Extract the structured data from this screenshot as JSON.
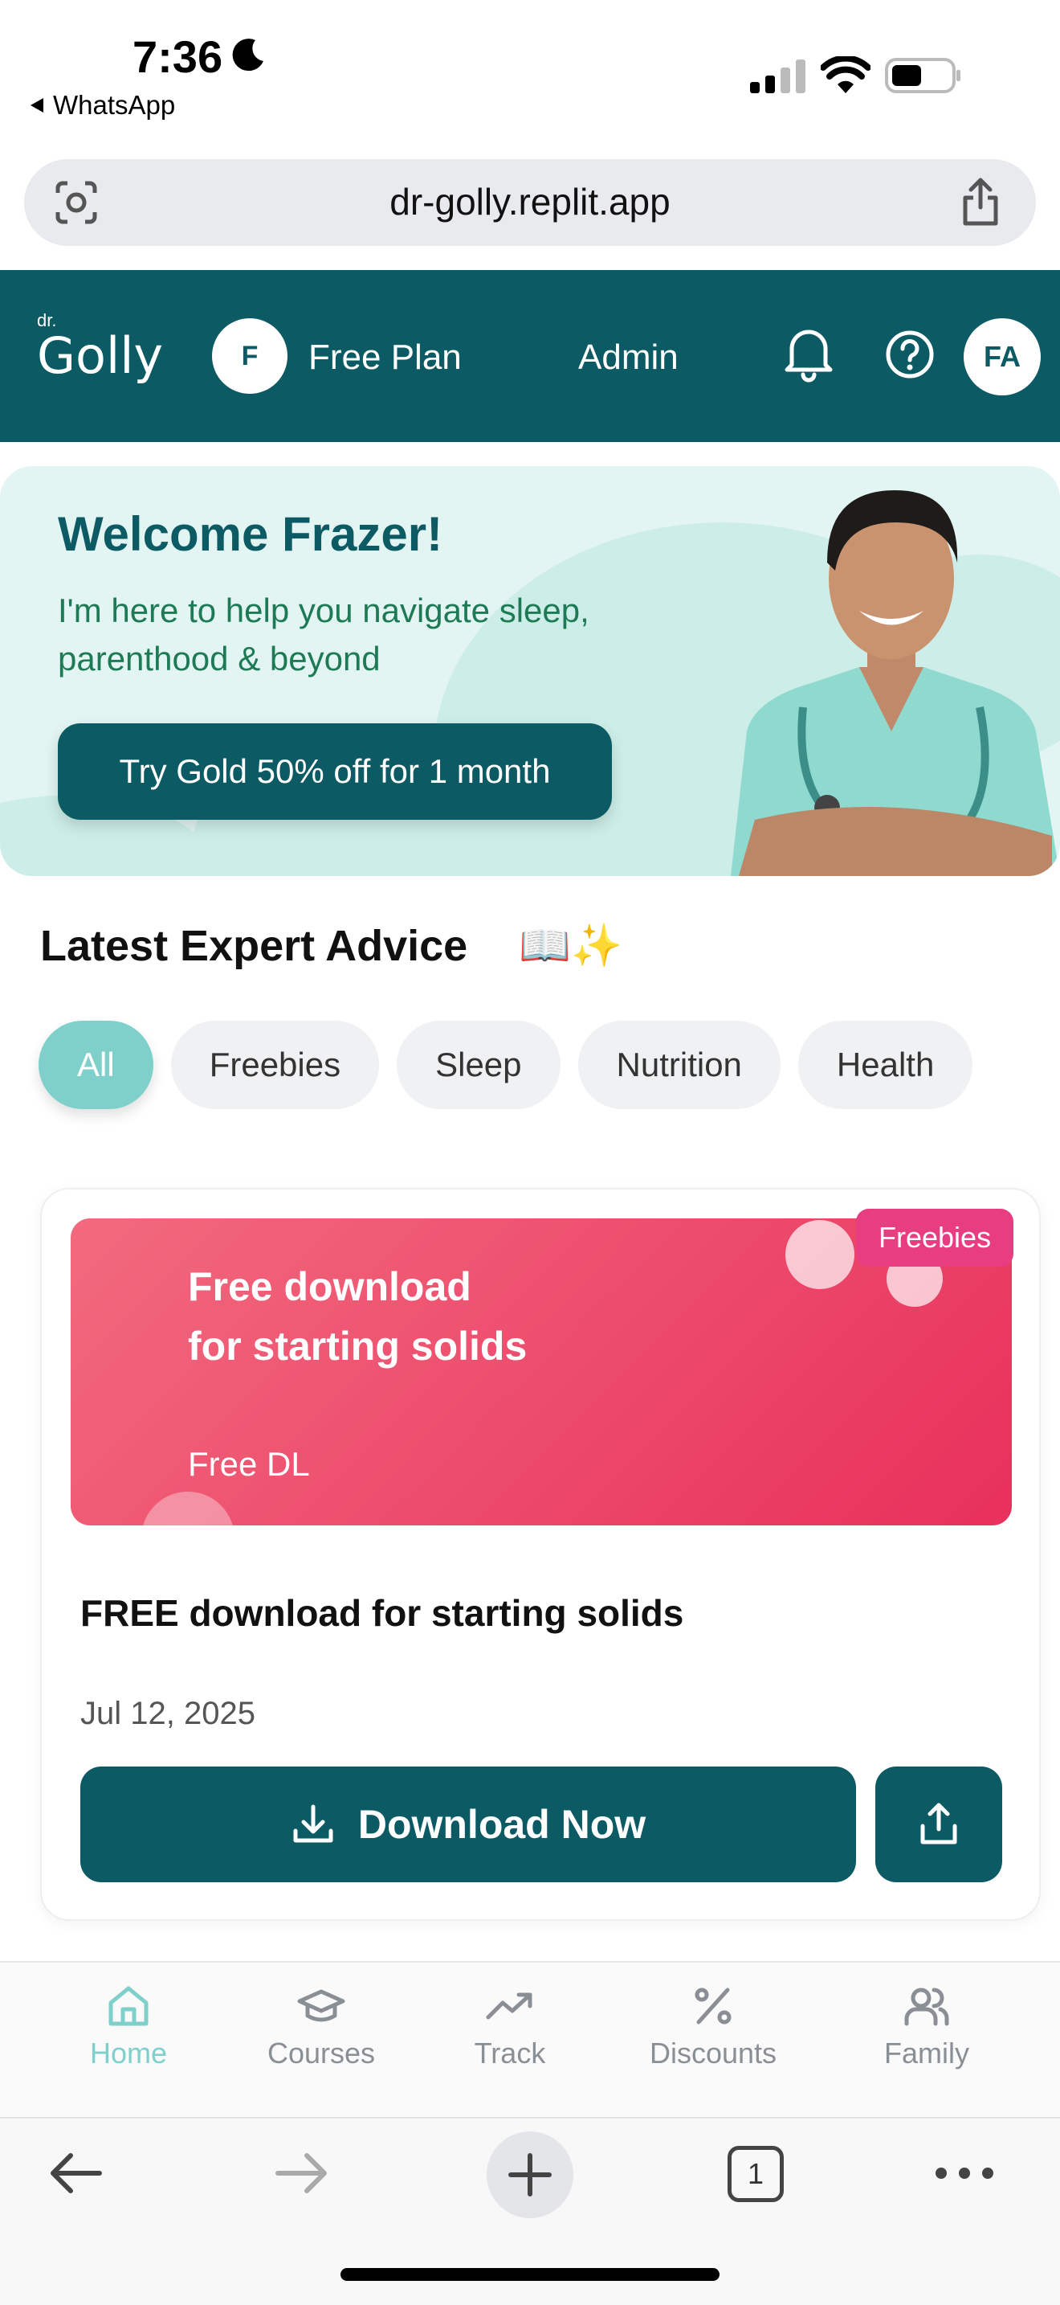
{
  "status_bar": {
    "time": "7:36",
    "back_app": "WhatsApp"
  },
  "browser": {
    "url": "dr-golly.replit.app",
    "tab_count": "1"
  },
  "header": {
    "logo_small": "dr.",
    "logo_text": "Golly",
    "plan_avatar_initial": "F",
    "plan_label": "Free Plan",
    "admin_label": "Admin",
    "user_initials": "FA",
    "brand_color": "#0c5a63"
  },
  "hero": {
    "title": "Welcome Frazer!",
    "subtitle": "I'm here to help you navigate sleep, parenthood & beyond",
    "cta_label": "Try Gold 50% off for 1 month"
  },
  "section": {
    "title": "Latest Expert Advice",
    "emoji": "📖✨"
  },
  "filters": {
    "active_index": 0,
    "items": [
      "All",
      "Freebies",
      "Sleep",
      "Nutrition",
      "Health"
    ]
  },
  "card": {
    "tag": "Freebies",
    "banner_title": "Free download for starting solids",
    "banner_subtitle": "Free DL",
    "title": "FREE download for starting solids",
    "date": "Jul 12, 2025",
    "download_label": "Download Now"
  },
  "bottom_nav": {
    "active": "Home",
    "items": [
      {
        "label": "Home",
        "icon": "home-icon"
      },
      {
        "label": "Courses",
        "icon": "graduation-cap-icon"
      },
      {
        "label": "Track",
        "icon": "trending-up-icon"
      },
      {
        "label": "Discounts",
        "icon": "percent-icon"
      },
      {
        "label": "Family",
        "icon": "users-icon"
      }
    ]
  },
  "colors": {
    "accent": "#7fd0cb",
    "freebies_tag": "#e93d82",
    "banner_start": "#f26a7e",
    "banner_end": "#e8305c"
  }
}
